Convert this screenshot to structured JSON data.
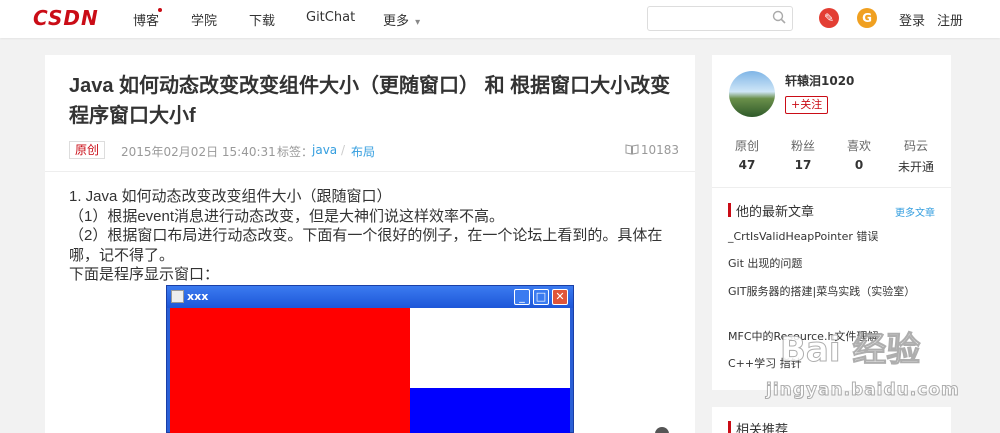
{
  "nav": {
    "logo": "CSDN",
    "items": [
      {
        "label": "博客",
        "has_dot": true
      },
      {
        "label": "学院"
      },
      {
        "label": "下载"
      },
      {
        "label": "GitChat"
      },
      {
        "label": "更多"
      }
    ],
    "more_caret": "▾",
    "search_placeholder": "",
    "write_icon_glyph": "✎",
    "gitchat_icon_glyph": "G",
    "login": "登录",
    "register": "注册",
    "colors": {
      "brand": "#ca0c16",
      "write_icon": "#e33e33",
      "gitchat_icon": "#f0a020"
    }
  },
  "article": {
    "title": "Java 如何动态改变改变组件大小（更随窗口） 和 根据窗口大小改变程序窗口大小f",
    "type_badge": "原创",
    "date": "2015年02月02日 15:40:31",
    "tags_label": "标签：",
    "tags": [
      "java",
      "布局"
    ],
    "tag_separator": "/",
    "views": "10183",
    "paragraphs": [
      "1. Java 如何动态改变改变组件大小（跟随窗口）",
      "（1）根据event消息进行动态改变，但是大神们说这样效率不高。",
      "（2）根据窗口布局进行动态改变。下面有一个很好的例子，在一个论坛上看到的。具体在哪，记不得了。",
      "下面是程序显示窗口："
    ],
    "window": {
      "title": "xxx",
      "min_glyph": "_",
      "max_glyph": "□",
      "close_glyph": "✕"
    }
  },
  "sidebar": {
    "username": "轩辕泪1020",
    "follow": "+关注",
    "stats": [
      {
        "label": "原创",
        "value": "47"
      },
      {
        "label": "粉丝",
        "value": "17"
      },
      {
        "label": "喜欢",
        "value": "0"
      },
      {
        "label": "码云",
        "value": "未开通"
      }
    ],
    "recent_title": "他的最新文章",
    "more": "更多文章",
    "recent": [
      "_CrtIsValidHeapPointer 错误",
      "Git 出现的问题",
      "GIT服务器的搭建|菜鸟实践（实验室）",
      "MFC中的Resource.h文件理解",
      "C++学习 指针"
    ],
    "related_title": "相关推荐"
  },
  "watermark": {
    "line1": "Bai 经验",
    "line2": "jingyan.baidu.com"
  }
}
